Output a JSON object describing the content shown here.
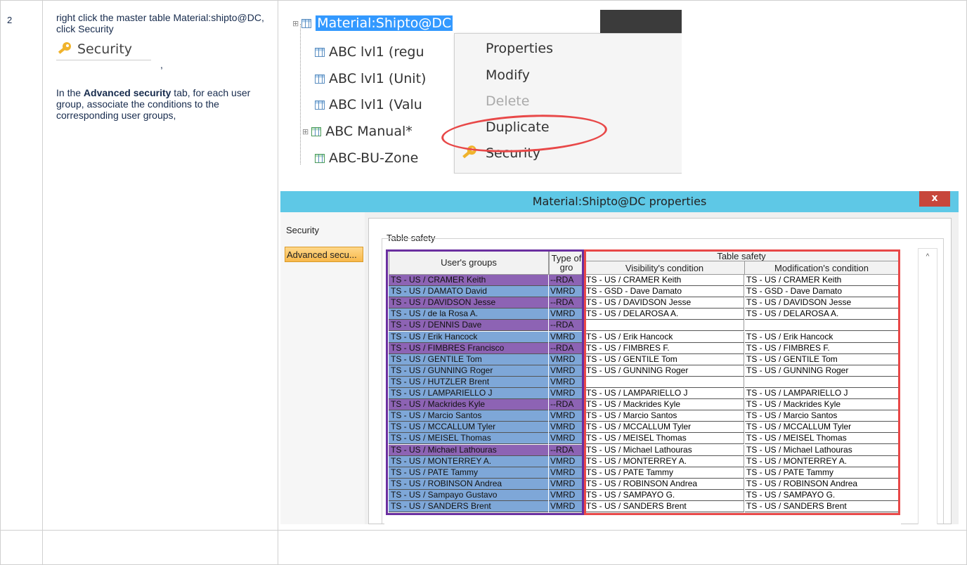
{
  "row": {
    "number": "2",
    "instruction_part1": "right click the master table Material:shipto@DC, click Security",
    "security_icon_label": "Security",
    "comma": ",",
    "instruction_part2_pre": "In the ",
    "instruction_part2_bold": "Advanced security",
    "instruction_part2_post": " tab, for each user group, associate the conditions to the corresponding user groups,"
  },
  "context_menu_screenshot": {
    "tree_items": [
      "Material:Shipto@DC",
      "ABC lvl1 (regu",
      "ABC lvl1 (Unit)",
      "ABC lvl1 (Valu",
      "ABC Manual*",
      "ABC-BU-Zone"
    ],
    "menu_items": [
      "Properties",
      "Modify",
      "Delete",
      "Duplicate",
      "Security"
    ]
  },
  "properties_dialog": {
    "title": "Material:Shipto@DC properties",
    "close_label": "x",
    "tabs": [
      "Security",
      "Advanced secu..."
    ],
    "section_label": "Table safety",
    "headers": {
      "users_groups": "User's groups",
      "type": "Type of gro",
      "table_safety": "Table safety",
      "visibility": "Visibility's condition",
      "modification": "Modification's condition"
    },
    "rows": [
      {
        "group": "TS - US / CRAMER Keith",
        "type": "--RDA",
        "vis": "TS - US / CRAMER Keith",
        "mod": "TS - US / CRAMER Keith",
        "tone": "purple"
      },
      {
        "group": "TS - US / DAMATO David",
        "type": "VMRD",
        "vis": "TS - GSD - Dave Damato",
        "mod": "TS - GSD - Dave Damato",
        "tone": "blue"
      },
      {
        "group": "TS - US / DAVIDSON Jesse",
        "type": "--RDA",
        "vis": "TS - US / DAVIDSON Jesse",
        "mod": "TS - US / DAVIDSON Jesse",
        "tone": "purple"
      },
      {
        "group": "TS - US / de la Rosa A.",
        "type": "VMRD",
        "vis": "TS - US / DELAROSA A.",
        "mod": "TS - US / DELAROSA A.",
        "tone": "blue"
      },
      {
        "group": "TS - US / DENNIS Dave",
        "type": "--RDA",
        "vis": "",
        "mod": "",
        "tone": "purple"
      },
      {
        "group": "TS - US / Erik Hancock",
        "type": "VMRD",
        "vis": "TS - US / Erik Hancock",
        "mod": "TS - US / Erik Hancock",
        "tone": "blue"
      },
      {
        "group": "TS - US / FIMBRES Francisco",
        "type": "--RDA",
        "vis": "TS - US / FIMBRES F.",
        "mod": "TS - US / FIMBRES F.",
        "tone": "purple"
      },
      {
        "group": "TS - US / GENTILE Tom",
        "type": "VMRD",
        "vis": "TS - US / GENTILE Tom",
        "mod": "TS - US / GENTILE Tom",
        "tone": "blue"
      },
      {
        "group": "TS - US / GUNNING Roger",
        "type": "VMRD",
        "vis": "TS - US / GUNNING Roger",
        "mod": "TS - US / GUNNING Roger",
        "tone": "blue"
      },
      {
        "group": "TS - US / HUTZLER Brent",
        "type": "VMRD",
        "vis": "",
        "mod": "",
        "tone": "blue"
      },
      {
        "group": "TS - US / LAMPARIELLO J",
        "type": "VMRD",
        "vis": "TS - US / LAMPARIELLO J",
        "mod": "TS - US / LAMPARIELLO J",
        "tone": "blue"
      },
      {
        "group": "TS - US / Mackrides Kyle",
        "type": "--RDA",
        "vis": "TS - US / Mackrides Kyle",
        "mod": "TS - US / Mackrides Kyle",
        "tone": "purple"
      },
      {
        "group": "TS - US / Marcio Santos",
        "type": "VMRD",
        "vis": "TS - US / Marcio Santos",
        "mod": "TS - US / Marcio Santos",
        "tone": "blue"
      },
      {
        "group": "TS - US / MCCALLUM Tyler",
        "type": "VMRD",
        "vis": "TS - US / MCCALLUM Tyler",
        "mod": "TS - US / MCCALLUM Tyler",
        "tone": "blue"
      },
      {
        "group": "TS - US / MEISEL Thomas",
        "type": "VMRD",
        "vis": "TS - US / MEISEL Thomas",
        "mod": "TS - US / MEISEL Thomas",
        "tone": "blue"
      },
      {
        "group": "TS - US / Michael Lathouras",
        "type": "--RDA",
        "vis": "TS - US / Michael Lathouras",
        "mod": "TS - US / Michael Lathouras",
        "tone": "purple"
      },
      {
        "group": "TS - US / MONTERREY A.",
        "type": "VMRD",
        "vis": "TS - US / MONTERREY A.",
        "mod": "TS - US / MONTERREY A.",
        "tone": "blue"
      },
      {
        "group": "TS - US / PATE Tammy",
        "type": "VMRD",
        "vis": "TS - US / PATE Tammy",
        "mod": "TS - US / PATE Tammy",
        "tone": "blue"
      },
      {
        "group": "TS - US / ROBINSON Andrea",
        "type": "VMRD",
        "vis": "TS - US / ROBINSON Andrea",
        "mod": "TS - US / ROBINSON Andrea",
        "tone": "blue"
      },
      {
        "group": "TS - US / Sampayo Gustavo",
        "type": "VMRD",
        "vis": "TS - US / SAMPAYO G.",
        "mod": "TS - US / SAMPAYO G.",
        "tone": "blue"
      },
      {
        "group": "TS - US / SANDERS Brent",
        "type": "VMRD",
        "vis": "TS - US / SANDERS Brent",
        "mod": "TS - US / SANDERS Brent",
        "tone": "blue"
      }
    ],
    "colors": {
      "purple_row": "#8d63b4",
      "blue_row": "#7ea7d8",
      "purple_border": "#6a2fa0",
      "red_border": "#e84848",
      "titlebar": "#5ec8e6"
    }
  }
}
